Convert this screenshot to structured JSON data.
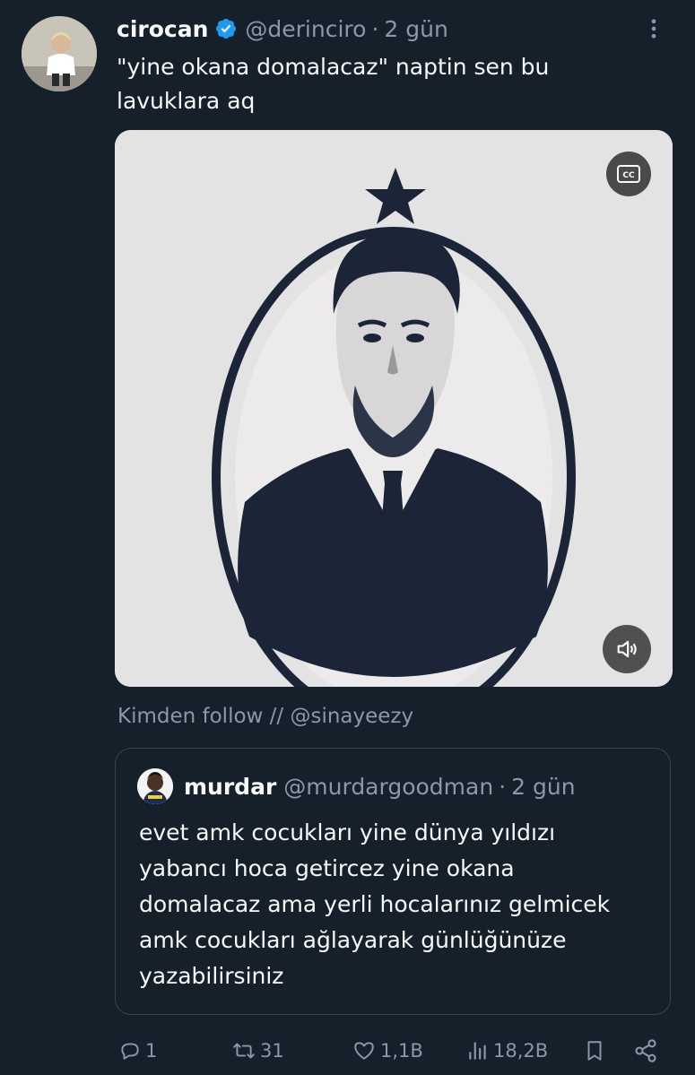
{
  "tweet": {
    "display_name": "cirocan",
    "handle": "@derinciro",
    "separator": "·",
    "time": "2 gün",
    "text": "\"yine okana domalacaz\" naptin sen bu lavuklara aq",
    "source": "Kimden follow // @sinayeezy"
  },
  "quote": {
    "display_name": "murdar",
    "handle": "@murdargoodman",
    "separator": "·",
    "time": "2 gün",
    "text": "evet amk cocukları yine dünya yıldızı yabancı hoca getircez yine okana domalacaz ama yerli hocalarınız gelmicek amk cocukları ağlayarak günlüğünüze yazabilirsiniz"
  },
  "actions": {
    "replies": "1",
    "retweets": "31",
    "likes": "1,1B",
    "views": "18,2B"
  },
  "media": {
    "cc_label": "CC"
  },
  "colors": {
    "background": "#15202b",
    "text": "#f7f9f9",
    "muted": "#8b98a5",
    "verified": "#1d9bf0",
    "border": "#38444d"
  }
}
